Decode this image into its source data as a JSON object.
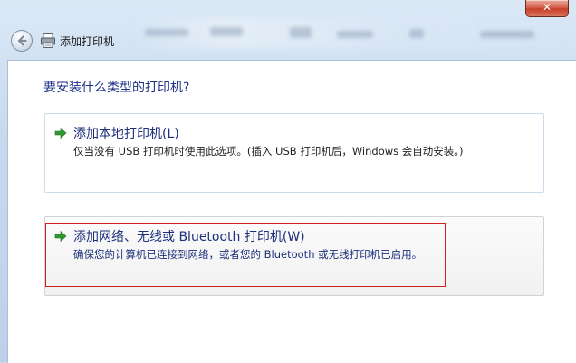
{
  "window": {
    "title": "添加打印机",
    "close_label": "✕"
  },
  "main": {
    "heading": "要安装什么类型的打印机?",
    "options": [
      {
        "title": "添加本地打印机(L)",
        "description": "仅当没有 USB 打印机时使用此选项。(插入 USB 打印机后，Windows 会自动安装。)"
      },
      {
        "title": "添加网络、无线或 Bluetooth 打印机(W)",
        "description": "确保您的计算机已连接到网络，或者您的 Bluetooth 或无线打印机已启用。"
      }
    ]
  },
  "colors": {
    "accent_text": "#1b2f7a",
    "arrow_green": "#2f9a2f",
    "highlight_red": "#d0211c",
    "close_red": "#c7402a"
  },
  "icons": {
    "back": "back-arrow-icon",
    "printer": "printer-icon",
    "option_arrow": "green-arrow-icon"
  }
}
